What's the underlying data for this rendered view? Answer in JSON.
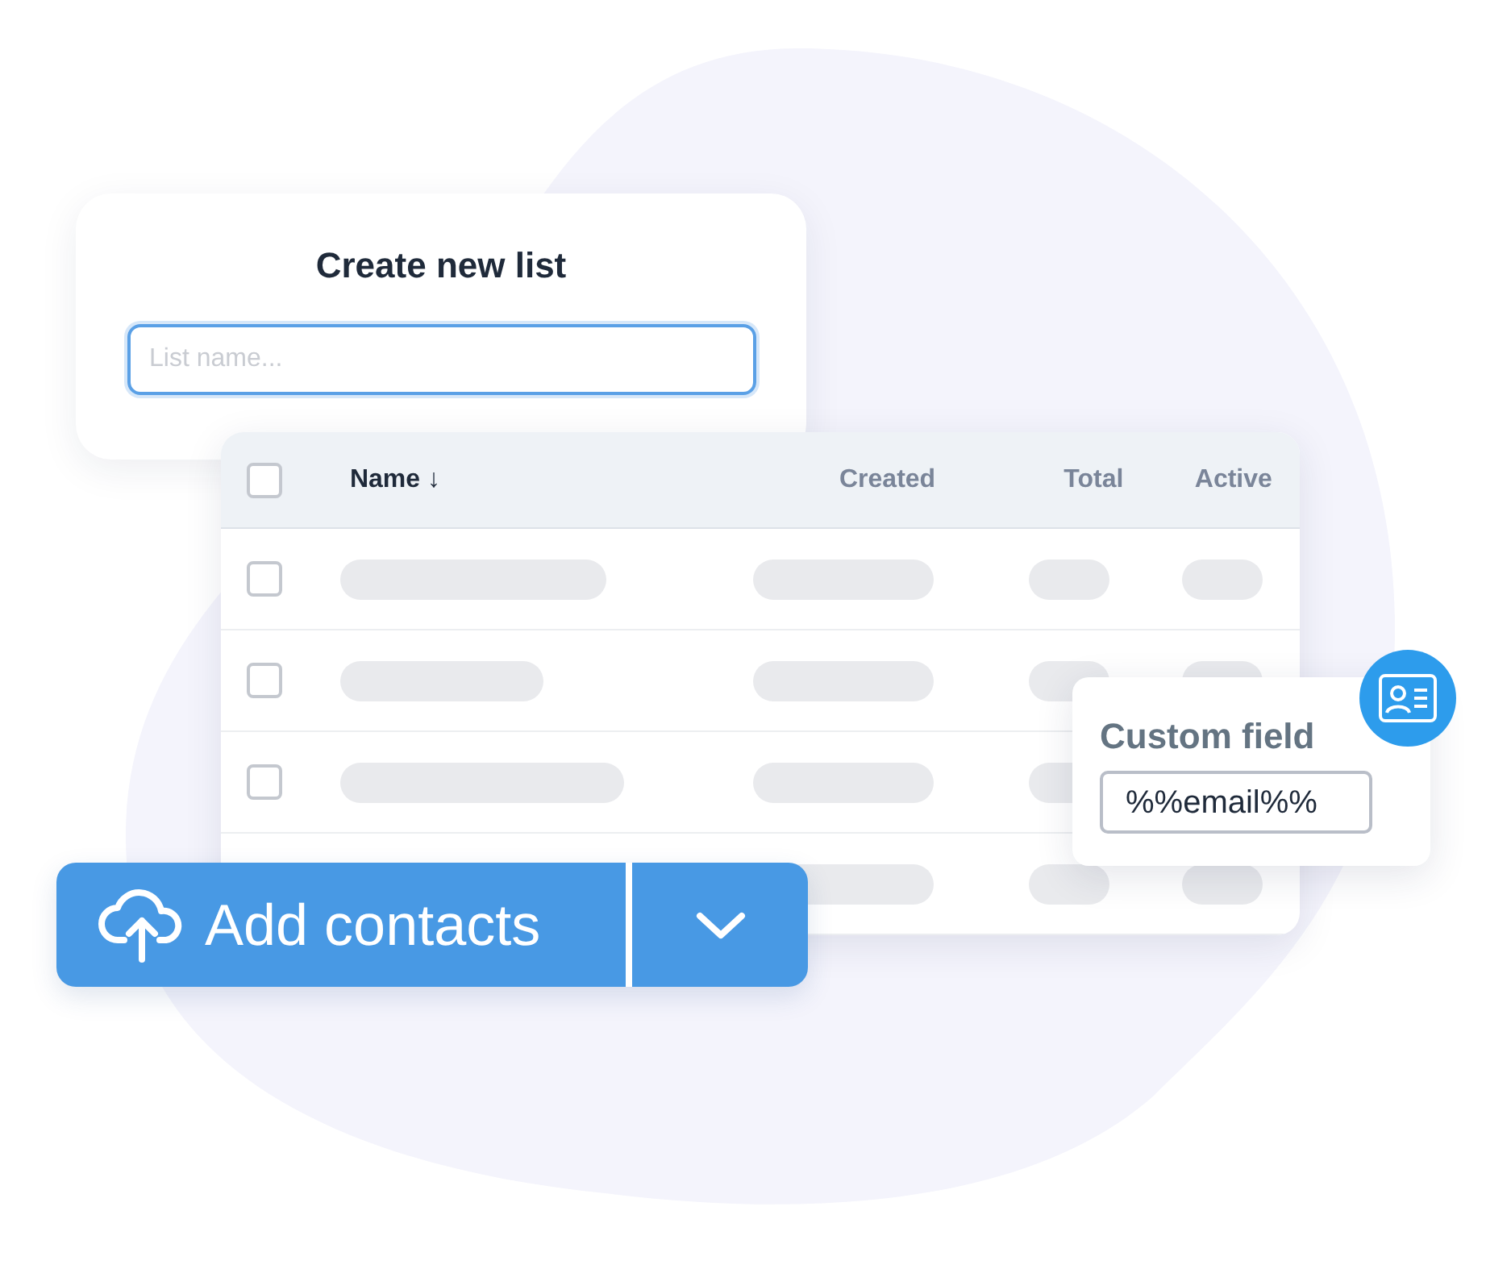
{
  "create_list": {
    "title": "Create new list",
    "field": {
      "placeholder": "List name...",
      "focused": true
    }
  },
  "table": {
    "header_checkbox": {
      "checked": false
    },
    "columns": [
      {
        "label": "Name",
        "sorted": true,
        "sort_arrow": "↓"
      },
      {
        "label": "Created",
        "sorted": false
      },
      {
        "label": "Total",
        "sorted": false
      },
      {
        "label": "Active",
        "sorted": false
      }
    ],
    "rows": [
      {
        "checked": false
      },
      {
        "checked": false
      },
      {
        "checked": false
      },
      {
        "partly_hidden": true
      }
    ]
  },
  "custom_field": {
    "title": "Custom field",
    "value": "%%email%%"
  },
  "add_contacts": {
    "label": "Add contacts"
  }
}
